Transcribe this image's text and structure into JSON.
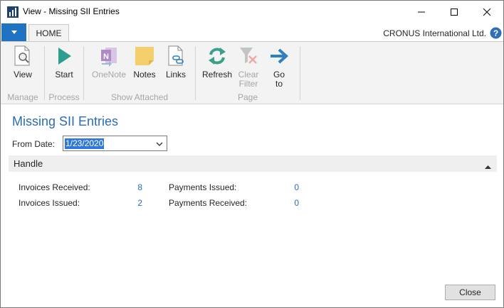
{
  "window": {
    "title": "View - Missing SII Entries"
  },
  "tabs": {
    "home_label": "HOME",
    "company": "CRONUS International Ltd."
  },
  "ribbon": {
    "buttons": {
      "view": "View",
      "start": "Start",
      "onenote": "OneNote",
      "notes": "Notes",
      "links": "Links",
      "refresh": "Refresh",
      "clear_filter_1": "Clear",
      "clear_filter_2": "Filter",
      "goto_1": "Go",
      "goto_2": "to"
    },
    "groups": {
      "manage": "Manage",
      "process": "Process",
      "show_attached": "Show Attached",
      "page": "Page"
    }
  },
  "page": {
    "title": "Missing SII Entries",
    "from_date_label": "From Date:",
    "from_date_value": "1/23/2020",
    "section_title": "Handle",
    "fields": {
      "invoices_received_label": "Invoices Received:",
      "invoices_received_value": "8",
      "invoices_issued_label": "Invoices Issued:",
      "invoices_issued_value": "2",
      "payments_issued_label": "Payments Issued:",
      "payments_issued_value": "0",
      "payments_received_label": "Payments Received:",
      "payments_received_value": "0"
    },
    "close_label": "Close"
  },
  "colors": {
    "accent": "#1f73c2",
    "link": "#2b6cb5",
    "ribbon_bg": "#f3f3f3",
    "disabled_text": "#a6a6a6",
    "selection": "#3078d6"
  }
}
